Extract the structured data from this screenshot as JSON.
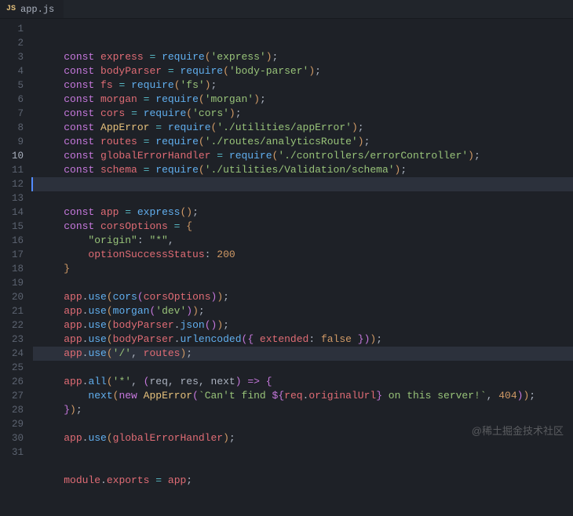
{
  "tab": {
    "icon_label": "JS",
    "filename": "app.js"
  },
  "active_line": 10,
  "highlighted_line": 22,
  "watermark": "@稀土掘金技术社区",
  "lines": [
    {
      "n": 1,
      "tokens": [
        {
          "t": "const ",
          "c": "kw"
        },
        {
          "t": "express",
          "c": "var"
        },
        {
          "t": " ",
          "c": "pn"
        },
        {
          "t": "=",
          "c": "op"
        },
        {
          "t": " ",
          "c": "pn"
        },
        {
          "t": "require",
          "c": "fn"
        },
        {
          "t": "(",
          "c": "b1"
        },
        {
          "t": "'express'",
          "c": "str"
        },
        {
          "t": ")",
          "c": "b1"
        },
        {
          "t": ";",
          "c": "pn"
        }
      ]
    },
    {
      "n": 2,
      "tokens": [
        {
          "t": "const ",
          "c": "kw"
        },
        {
          "t": "bodyParser",
          "c": "var"
        },
        {
          "t": " ",
          "c": "pn"
        },
        {
          "t": "=",
          "c": "op"
        },
        {
          "t": " ",
          "c": "pn"
        },
        {
          "t": "require",
          "c": "fn"
        },
        {
          "t": "(",
          "c": "b1"
        },
        {
          "t": "'body-parser'",
          "c": "str"
        },
        {
          "t": ")",
          "c": "b1"
        },
        {
          "t": ";",
          "c": "pn"
        }
      ]
    },
    {
      "n": 3,
      "tokens": [
        {
          "t": "const ",
          "c": "kw"
        },
        {
          "t": "fs",
          "c": "var"
        },
        {
          "t": " ",
          "c": "pn"
        },
        {
          "t": "=",
          "c": "op"
        },
        {
          "t": " ",
          "c": "pn"
        },
        {
          "t": "require",
          "c": "fn"
        },
        {
          "t": "(",
          "c": "b1"
        },
        {
          "t": "'fs'",
          "c": "str"
        },
        {
          "t": ")",
          "c": "b1"
        },
        {
          "t": ";",
          "c": "pn"
        }
      ]
    },
    {
      "n": 4,
      "tokens": [
        {
          "t": "const ",
          "c": "kw"
        },
        {
          "t": "morgan",
          "c": "var"
        },
        {
          "t": " ",
          "c": "pn"
        },
        {
          "t": "=",
          "c": "op"
        },
        {
          "t": " ",
          "c": "pn"
        },
        {
          "t": "require",
          "c": "fn"
        },
        {
          "t": "(",
          "c": "b1"
        },
        {
          "t": "'morgan'",
          "c": "str"
        },
        {
          "t": ")",
          "c": "b1"
        },
        {
          "t": ";",
          "c": "pn"
        }
      ]
    },
    {
      "n": 5,
      "tokens": [
        {
          "t": "const ",
          "c": "kw"
        },
        {
          "t": "cors",
          "c": "var"
        },
        {
          "t": " ",
          "c": "pn"
        },
        {
          "t": "=",
          "c": "op"
        },
        {
          "t": " ",
          "c": "pn"
        },
        {
          "t": "require",
          "c": "fn"
        },
        {
          "t": "(",
          "c": "b1"
        },
        {
          "t": "'cors'",
          "c": "str"
        },
        {
          "t": ")",
          "c": "b1"
        },
        {
          "t": ";",
          "c": "pn"
        }
      ]
    },
    {
      "n": 6,
      "tokens": [
        {
          "t": "const ",
          "c": "kw"
        },
        {
          "t": "AppError",
          "c": "con"
        },
        {
          "t": " ",
          "c": "pn"
        },
        {
          "t": "=",
          "c": "op"
        },
        {
          "t": " ",
          "c": "pn"
        },
        {
          "t": "require",
          "c": "fn"
        },
        {
          "t": "(",
          "c": "b1"
        },
        {
          "t": "'./utilities/appError'",
          "c": "str"
        },
        {
          "t": ")",
          "c": "b1"
        },
        {
          "t": ";",
          "c": "pn"
        }
      ]
    },
    {
      "n": 7,
      "tokens": [
        {
          "t": "const ",
          "c": "kw"
        },
        {
          "t": "routes",
          "c": "var"
        },
        {
          "t": " ",
          "c": "pn"
        },
        {
          "t": "=",
          "c": "op"
        },
        {
          "t": " ",
          "c": "pn"
        },
        {
          "t": "require",
          "c": "fn"
        },
        {
          "t": "(",
          "c": "b1"
        },
        {
          "t": "'./routes/analyticsRoute'",
          "c": "str"
        },
        {
          "t": ")",
          "c": "b1"
        },
        {
          "t": ";",
          "c": "pn"
        }
      ]
    },
    {
      "n": 8,
      "tokens": [
        {
          "t": "const ",
          "c": "kw"
        },
        {
          "t": "globalErrorHandler",
          "c": "var"
        },
        {
          "t": " ",
          "c": "pn"
        },
        {
          "t": "=",
          "c": "op"
        },
        {
          "t": " ",
          "c": "pn"
        },
        {
          "t": "require",
          "c": "fn"
        },
        {
          "t": "(",
          "c": "b1"
        },
        {
          "t": "'./controllers/errorController'",
          "c": "str"
        },
        {
          "t": ")",
          "c": "b1"
        },
        {
          "t": ";",
          "c": "pn"
        }
      ]
    },
    {
      "n": 9,
      "tokens": [
        {
          "t": "const ",
          "c": "kw"
        },
        {
          "t": "schema",
          "c": "var"
        },
        {
          "t": " ",
          "c": "pn"
        },
        {
          "t": "=",
          "c": "op"
        },
        {
          "t": " ",
          "c": "pn"
        },
        {
          "t": "require",
          "c": "fn"
        },
        {
          "t": "(",
          "c": "b1"
        },
        {
          "t": "'./utilities/Validation/schema'",
          "c": "str"
        },
        {
          "t": ")",
          "c": "b1"
        },
        {
          "t": ";",
          "c": "pn"
        }
      ]
    },
    {
      "n": 10,
      "tokens": []
    },
    {
      "n": 11,
      "tokens": []
    },
    {
      "n": 12,
      "tokens": [
        {
          "t": "const ",
          "c": "kw"
        },
        {
          "t": "app",
          "c": "var"
        },
        {
          "t": " ",
          "c": "pn"
        },
        {
          "t": "=",
          "c": "op"
        },
        {
          "t": " ",
          "c": "pn"
        },
        {
          "t": "express",
          "c": "fn"
        },
        {
          "t": "(",
          "c": "b1"
        },
        {
          "t": ")",
          "c": "b1"
        },
        {
          "t": ";",
          "c": "pn"
        }
      ]
    },
    {
      "n": 13,
      "tokens": [
        {
          "t": "const ",
          "c": "kw"
        },
        {
          "t": "corsOptions",
          "c": "var"
        },
        {
          "t": " ",
          "c": "pn"
        },
        {
          "t": "=",
          "c": "op"
        },
        {
          "t": " ",
          "c": "pn"
        },
        {
          "t": "{",
          "c": "b1"
        }
      ]
    },
    {
      "n": 14,
      "indent": 1,
      "tokens": [
        {
          "t": "\"origin\"",
          "c": "str"
        },
        {
          "t": ": ",
          "c": "pn"
        },
        {
          "t": "\"*\"",
          "c": "str"
        },
        {
          "t": ",",
          "c": "pn"
        }
      ]
    },
    {
      "n": 15,
      "indent": 1,
      "tokens": [
        {
          "t": "optionSuccessStatus",
          "c": "prop"
        },
        {
          "t": ": ",
          "c": "pn"
        },
        {
          "t": "200",
          "c": "num"
        }
      ]
    },
    {
      "n": 16,
      "tokens": [
        {
          "t": "}",
          "c": "b1"
        }
      ]
    },
    {
      "n": 17,
      "tokens": []
    },
    {
      "n": 18,
      "tokens": [
        {
          "t": "app",
          "c": "var"
        },
        {
          "t": ".",
          "c": "pn"
        },
        {
          "t": "use",
          "c": "fn"
        },
        {
          "t": "(",
          "c": "b1"
        },
        {
          "t": "cors",
          "c": "fn"
        },
        {
          "t": "(",
          "c": "b2"
        },
        {
          "t": "corsOptions",
          "c": "var"
        },
        {
          "t": ")",
          "c": "b2"
        },
        {
          "t": ")",
          "c": "b1"
        },
        {
          "t": ";",
          "c": "pn"
        }
      ]
    },
    {
      "n": 19,
      "tokens": [
        {
          "t": "app",
          "c": "var"
        },
        {
          "t": ".",
          "c": "pn"
        },
        {
          "t": "use",
          "c": "fn"
        },
        {
          "t": "(",
          "c": "b1"
        },
        {
          "t": "morgan",
          "c": "fn"
        },
        {
          "t": "(",
          "c": "b2"
        },
        {
          "t": "'dev'",
          "c": "str"
        },
        {
          "t": ")",
          "c": "b2"
        },
        {
          "t": ")",
          "c": "b1"
        },
        {
          "t": ";",
          "c": "pn"
        }
      ]
    },
    {
      "n": 20,
      "tokens": [
        {
          "t": "app",
          "c": "var"
        },
        {
          "t": ".",
          "c": "pn"
        },
        {
          "t": "use",
          "c": "fn"
        },
        {
          "t": "(",
          "c": "b1"
        },
        {
          "t": "bodyParser",
          "c": "var"
        },
        {
          "t": ".",
          "c": "pn"
        },
        {
          "t": "json",
          "c": "fn"
        },
        {
          "t": "(",
          "c": "b2"
        },
        {
          "t": ")",
          "c": "b2"
        },
        {
          "t": ")",
          "c": "b1"
        },
        {
          "t": ";",
          "c": "pn"
        }
      ]
    },
    {
      "n": 21,
      "tokens": [
        {
          "t": "app",
          "c": "var"
        },
        {
          "t": ".",
          "c": "pn"
        },
        {
          "t": "use",
          "c": "fn"
        },
        {
          "t": "(",
          "c": "b1"
        },
        {
          "t": "bodyParser",
          "c": "var"
        },
        {
          "t": ".",
          "c": "pn"
        },
        {
          "t": "urlencoded",
          "c": "fn"
        },
        {
          "t": "(",
          "c": "b2"
        },
        {
          "t": "{ ",
          "c": "brc"
        },
        {
          "t": "extended",
          "c": "prop"
        },
        {
          "t": ": ",
          "c": "pn"
        },
        {
          "t": "false",
          "c": "bool"
        },
        {
          "t": " }",
          "c": "brc"
        },
        {
          "t": ")",
          "c": "b2"
        },
        {
          "t": ")",
          "c": "b1"
        },
        {
          "t": ";",
          "c": "pn"
        }
      ]
    },
    {
      "n": 22,
      "tokens": [
        {
          "t": "app",
          "c": "var"
        },
        {
          "t": ".",
          "c": "pn"
        },
        {
          "t": "use",
          "c": "fn"
        },
        {
          "t": "(",
          "c": "b1"
        },
        {
          "t": "'/'",
          "c": "str"
        },
        {
          "t": ", ",
          "c": "pn"
        },
        {
          "t": "routes",
          "c": "var"
        },
        {
          "t": ")",
          "c": "b1"
        },
        {
          "t": ";",
          "c": "pn"
        }
      ]
    },
    {
      "n": 23,
      "tokens": []
    },
    {
      "n": 24,
      "tokens": [
        {
          "t": "app",
          "c": "var"
        },
        {
          "t": ".",
          "c": "pn"
        },
        {
          "t": "all",
          "c": "fn"
        },
        {
          "t": "(",
          "c": "b1"
        },
        {
          "t": "'*'",
          "c": "str"
        },
        {
          "t": ", ",
          "c": "pn"
        },
        {
          "t": "(",
          "c": "b2"
        },
        {
          "t": "req",
          "c": "par"
        },
        {
          "t": ", ",
          "c": "pn"
        },
        {
          "t": "res",
          "c": "par"
        },
        {
          "t": ", ",
          "c": "pn"
        },
        {
          "t": "next",
          "c": "par"
        },
        {
          "t": ")",
          "c": "b2"
        },
        {
          "t": " ",
          "c": "pn"
        },
        {
          "t": "=>",
          "c": "kw"
        },
        {
          "t": " ",
          "c": "pn"
        },
        {
          "t": "{",
          "c": "b2"
        }
      ]
    },
    {
      "n": 25,
      "indent": 1,
      "tokens": [
        {
          "t": "next",
          "c": "fn"
        },
        {
          "t": "(",
          "c": "b1"
        },
        {
          "t": "new ",
          "c": "kw"
        },
        {
          "t": "AppError",
          "c": "con"
        },
        {
          "t": "(",
          "c": "b2"
        },
        {
          "t": "`Can't find ",
          "c": "tpl"
        },
        {
          "t": "${",
          "c": "kw"
        },
        {
          "t": "req",
          "c": "int"
        },
        {
          "t": ".",
          "c": "pn"
        },
        {
          "t": "originalUrl",
          "c": "int"
        },
        {
          "t": "}",
          "c": "kw"
        },
        {
          "t": " on this server!`",
          "c": "tpl"
        },
        {
          "t": ", ",
          "c": "pn"
        },
        {
          "t": "404",
          "c": "num"
        },
        {
          "t": ")",
          "c": "b2"
        },
        {
          "t": ")",
          "c": "b1"
        },
        {
          "t": ";",
          "c": "pn"
        }
      ]
    },
    {
      "n": 26,
      "tokens": [
        {
          "t": "}",
          "c": "b2"
        },
        {
          "t": ")",
          "c": "b1"
        },
        {
          "t": ";",
          "c": "pn"
        }
      ]
    },
    {
      "n": 27,
      "tokens": []
    },
    {
      "n": 28,
      "tokens": [
        {
          "t": "app",
          "c": "var"
        },
        {
          "t": ".",
          "c": "pn"
        },
        {
          "t": "use",
          "c": "fn"
        },
        {
          "t": "(",
          "c": "b1"
        },
        {
          "t": "globalErrorHandler",
          "c": "var"
        },
        {
          "t": ")",
          "c": "b1"
        },
        {
          "t": ";",
          "c": "pn"
        }
      ]
    },
    {
      "n": 29,
      "tokens": []
    },
    {
      "n": 30,
      "tokens": []
    },
    {
      "n": 31,
      "tokens": [
        {
          "t": "module",
          "c": "var"
        },
        {
          "t": ".",
          "c": "pn"
        },
        {
          "t": "exports",
          "c": "prop"
        },
        {
          "t": " ",
          "c": "pn"
        },
        {
          "t": "=",
          "c": "op"
        },
        {
          "t": " ",
          "c": "pn"
        },
        {
          "t": "app",
          "c": "var"
        },
        {
          "t": ";",
          "c": "pn"
        }
      ]
    }
  ]
}
